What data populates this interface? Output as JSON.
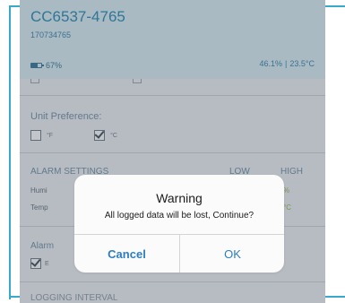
{
  "device": {
    "title": "CC6537-4765",
    "serial": "170734765",
    "battery_percent": 67,
    "battery_label": "67%",
    "humidity": "46.1%",
    "separator": "|",
    "temperature": "23.5°C"
  },
  "unit_preference": {
    "label": "Unit Preference:",
    "fahrenheit_label": "°F",
    "celsius_label": "°C",
    "fahrenheit_checked": false,
    "celsius_checked": true
  },
  "alarm_settings": {
    "header": "ALARM SETTINGS",
    "low_label": "LOW",
    "high_label": "HIGH",
    "row1_label": "Humi",
    "row1_high": "%",
    "row2_label": "Temp",
    "row2_high": "°C"
  },
  "alarm_notify": {
    "label": "Alarm",
    "email_label": "E"
  },
  "logging": {
    "label": "LOGGING INTERVAL"
  },
  "dialog": {
    "title": "Warning",
    "message": "All logged data will be lost, Continue?",
    "cancel_label": "Cancel",
    "ok_label": "OK"
  },
  "colors": {
    "accent": "#2c7ec2",
    "header_bg": "#d9eef6",
    "border": "#3aa8c9",
    "high_value": "#8fb84a"
  }
}
